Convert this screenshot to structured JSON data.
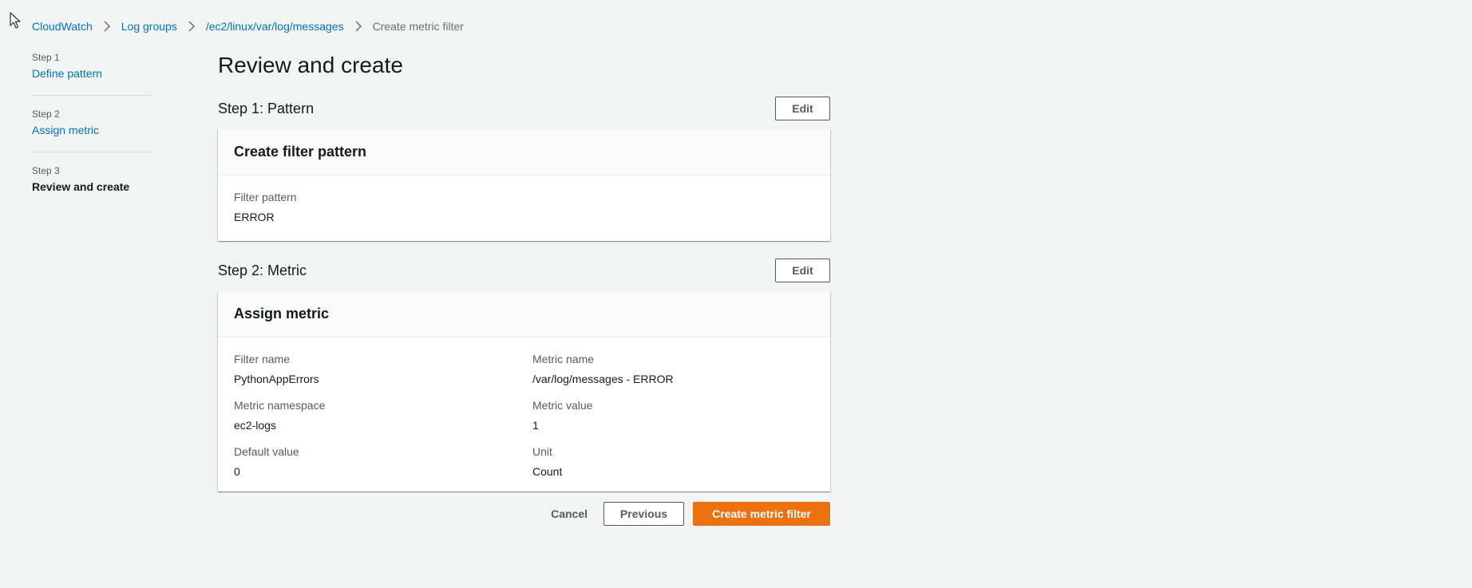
{
  "breadcrumbs": [
    {
      "label": "CloudWatch",
      "current": false
    },
    {
      "label": "Log groups",
      "current": false
    },
    {
      "label": "/ec2/linux/var/log/messages",
      "current": false
    },
    {
      "label": "Create metric filter",
      "current": true
    }
  ],
  "steps": [
    {
      "number": "Step 1",
      "title": "Define pattern"
    },
    {
      "number": "Step 2",
      "title": "Assign metric"
    },
    {
      "number": "Step 3",
      "title": "Review and create"
    }
  ],
  "page_title": "Review and create",
  "section1": {
    "title": "Step 1: Pattern",
    "edit_label": "Edit",
    "card_title": "Create filter pattern",
    "filter_pattern_label": "Filter pattern",
    "filter_pattern_value": "ERROR"
  },
  "section2": {
    "title": "Step 2: Metric",
    "edit_label": "Edit",
    "card_title": "Assign metric",
    "filter_name_label": "Filter name",
    "filter_name_value": "PythonAppErrors",
    "metric_name_label": "Metric name",
    "metric_name_value": "/var/log/messages - ERROR",
    "metric_namespace_label": "Metric namespace",
    "metric_namespace_value": "ec2-logs",
    "metric_value_label": "Metric value",
    "metric_value_value": "1",
    "default_value_label": "Default value",
    "default_value_value": "0",
    "unit_label": "Unit",
    "unit_value": "Count"
  },
  "actions": {
    "cancel_label": "Cancel",
    "previous_label": "Previous",
    "create_label": "Create metric filter"
  },
  "colors": {
    "accent": "#ec7211",
    "link": "#0073bb",
    "background": "#f2f3f3"
  },
  "icons": {
    "cursor": "mouse-pointer-icon",
    "breadcrumb_separator": "chevron-right-icon"
  }
}
